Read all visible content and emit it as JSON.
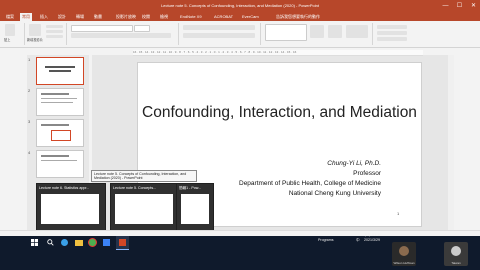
{
  "window": {
    "title": "Lecture note 5. Concepts of Confounding, Interaction, and Mediation (2020) - PowerPoint",
    "user": "",
    "minimize_icon": "minimize-icon",
    "maximize_icon": "maximize-icon",
    "close_icon": "close-icon"
  },
  "ribbon_tabs": [
    "檔案",
    "常用",
    "插入",
    "設計",
    "轉場",
    "動畫",
    "投影片放映",
    "校閱",
    "檢視",
    "EndNote X9",
    "ACROBAT",
    "EverCam",
    "告訴我您想要執行的動作"
  ],
  "active_tab_index": 1,
  "ribbon": {
    "groups": [
      "剪貼簿",
      "投影片",
      "字型",
      "段落",
      "繪圖",
      "編輯"
    ],
    "new_slide": "新增投影片",
    "paste": "貼上"
  },
  "slide": {
    "title": "Confounding, Interaction, and Mediation",
    "author": "Chung-Yi Li,  Ph.D.",
    "role": "Professor",
    "dept": "Department of Public Health, College of Medicine",
    "univ": "National Cheng Kung University",
    "number": "1"
  },
  "thumbnails": [
    "1",
    "2",
    "3",
    "4"
  ],
  "taskbar_previews": [
    {
      "title": "Lecture note 6. Statistics appr..."
    },
    {
      "title": "Lecture note 5. Concepts..."
    },
    {
      "title": "簡報1 - Pow..."
    }
  ],
  "tooltip": "Lecture note 5. Concepts of Confounding, Interaction, and Mediation (2020) - PowerPoint",
  "tray": {
    "time": "下午 01:11",
    "date": "2021/3/29",
    "programs": "Programs",
    "lang": "中"
  },
  "participants": [
    {
      "name": "Wilson Huffman"
    },
    {
      "name": "Taiwan"
    }
  ],
  "colors": {
    "accent": "#b7472a"
  }
}
